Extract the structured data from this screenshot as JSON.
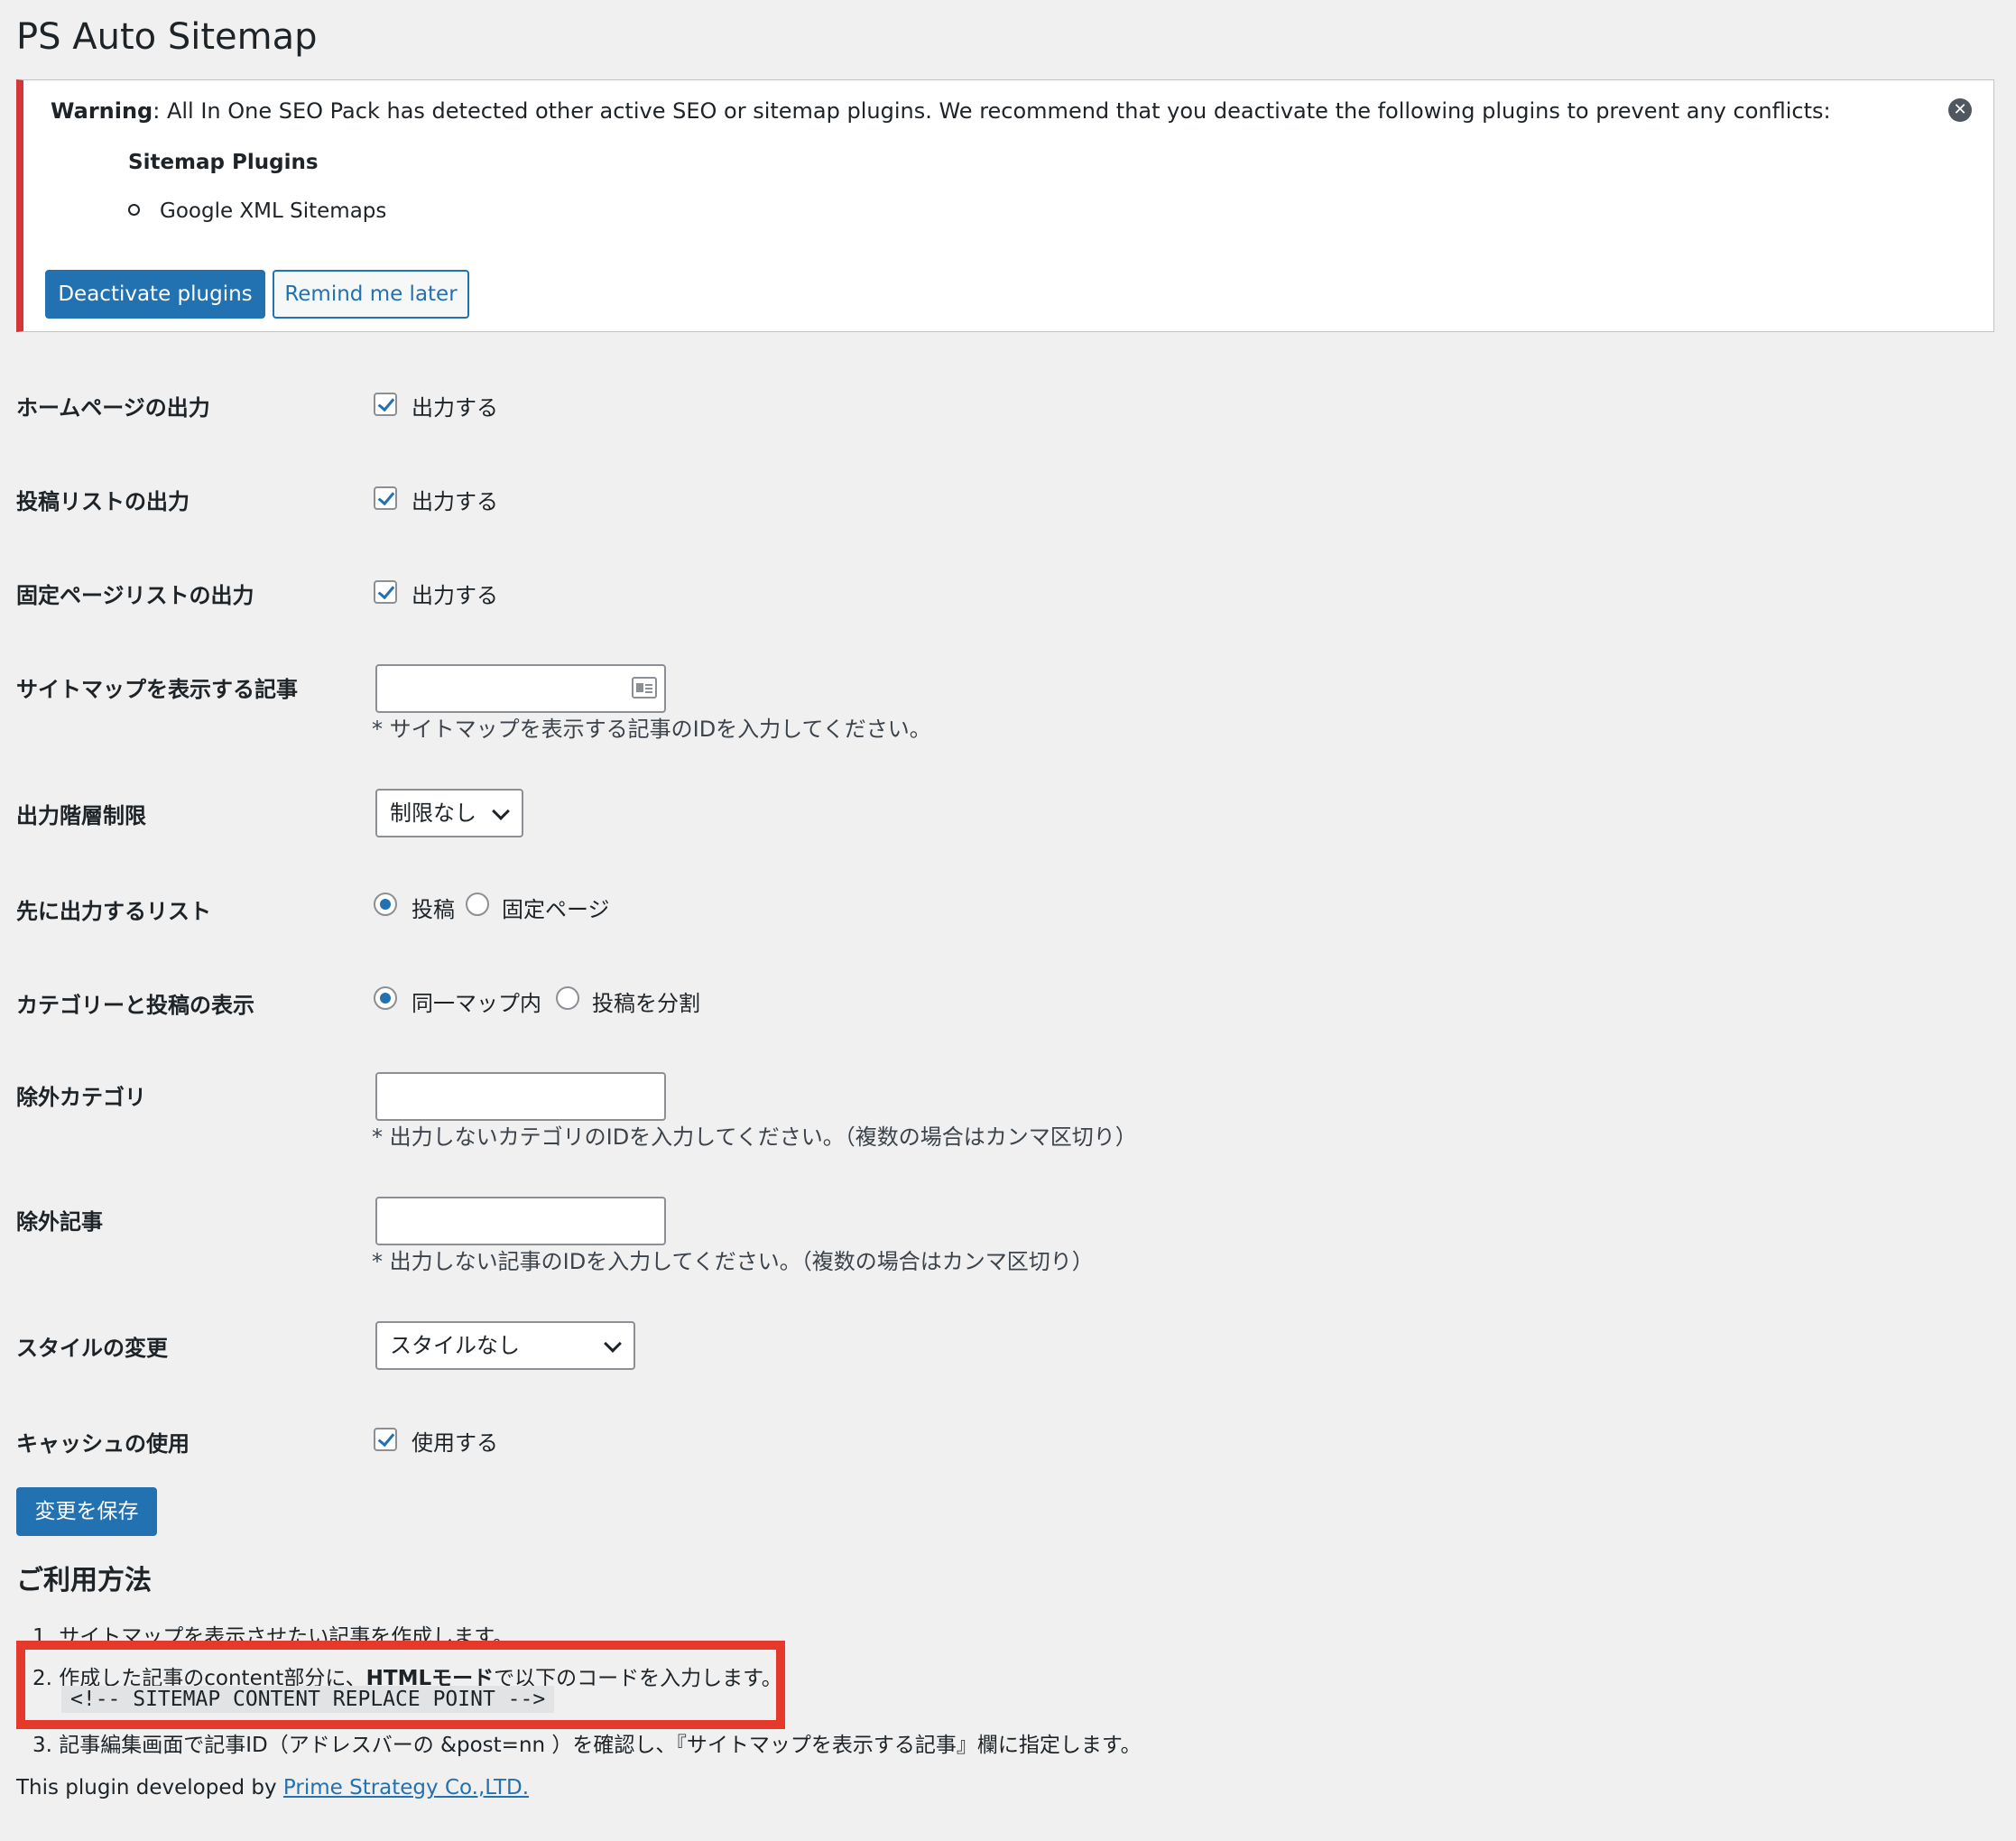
{
  "page": {
    "title": "PS Auto Sitemap"
  },
  "notice": {
    "prefix": "Warning",
    "message": ": All In One SEO Pack has detected other active SEO or sitemap plugins. We recommend that you deactivate the following plugins to prevent any conflicts:",
    "subheading": "Sitemap Plugins",
    "plugins": [
      "Google XML Sitemaps"
    ],
    "deactivate_label": "Deactivate plugins",
    "remind_label": "Remind me later",
    "close_icon": "close-circle-icon"
  },
  "settings": {
    "homepage": {
      "label": "ホームページの出力",
      "option": "出力する",
      "checked": true
    },
    "posts_list": {
      "label": "投稿リストの出力",
      "option": "出力する",
      "checked": true
    },
    "pages_list": {
      "label": "固定ページリストの出力",
      "option": "出力する",
      "checked": true
    },
    "sitemap_post": {
      "label": "サイトマップを表示する記事",
      "value": "",
      "description": "* サイトマップを表示する記事のIDを入力してください。",
      "icon": "contact-card-icon"
    },
    "depth_limit": {
      "label": "出力階層制限",
      "selected": "制限なし"
    },
    "first_list": {
      "label": "先に出力するリスト",
      "options": [
        "投稿",
        "固定ページ"
      ],
      "selected": "投稿"
    },
    "category_display": {
      "label": "カテゴリーと投稿の表示",
      "options": [
        "同一マップ内",
        "投稿を分割"
      ],
      "selected": "同一マップ内"
    },
    "exclude_categories": {
      "label": "除外カテゴリ",
      "value": "",
      "description": "* 出力しないカテゴリのIDを入力してください。（複数の場合はカンマ区切り）"
    },
    "exclude_posts": {
      "label": "除外記事",
      "value": "",
      "description": "* 出力しない記事のIDを入力してください。（複数の場合はカンマ区切り）"
    },
    "style": {
      "label": "スタイルの変更",
      "selected": "スタイルなし"
    },
    "cache": {
      "label": "キャッシュの使用",
      "option": "使用する",
      "checked": true
    }
  },
  "save_label": "変更を保存",
  "usage": {
    "heading": "ご利用方法",
    "step1": "1. サイトマップを表示させたい記事を作成します。",
    "step2_pre": "2. 作成した記事のcontent部分に、",
    "step2_bold": "HTMLモード",
    "step2_post": "で以下のコードを入力します。",
    "code": "<!-- SITEMAP CONTENT REPLACE POINT -->",
    "step3": "3. 記事編集画面で記事ID（アドレスバーの &post=nn ）を確認し、『サイトマップを表示する記事』欄に指定します。",
    "highlight_color": "#e53a2b"
  },
  "footer": {
    "text": "This plugin developed by ",
    "link": "Prime Strategy Co.,LTD."
  }
}
